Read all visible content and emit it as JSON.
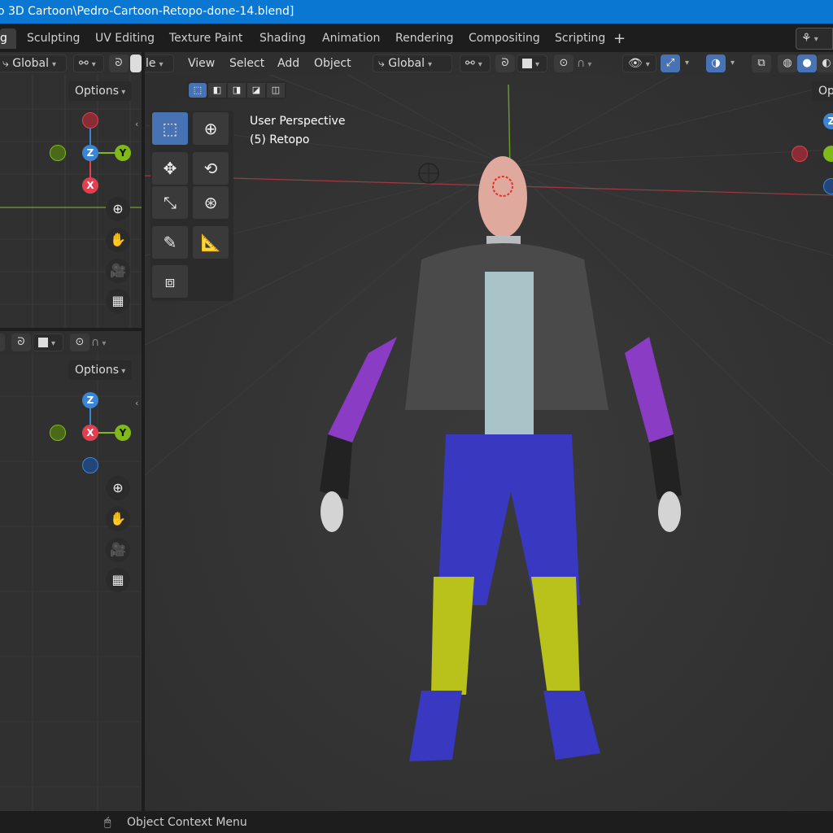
{
  "window": {
    "title": "o 3D Cartoon\\Pedro-Cartoon-Retopo-done-14.blend]"
  },
  "workspaces": {
    "tabs": [
      {
        "label": "g",
        "active": true
      },
      {
        "label": "Sculpting"
      },
      {
        "label": "UV Editing"
      },
      {
        "label": "Texture Paint"
      },
      {
        "label": "Shading"
      },
      {
        "label": "Animation"
      },
      {
        "label": "Rendering"
      },
      {
        "label": "Compositing"
      },
      {
        "label": "Scripting"
      }
    ],
    "add_label": "+"
  },
  "left_top": {
    "orientation": "Global",
    "options_label": "Options",
    "gizmo": {
      "x": "X",
      "y": "Y",
      "z": "Z"
    }
  },
  "left_bottom": {
    "options_label": "Options",
    "gizmo": {
      "x": "X",
      "y": "Y",
      "z": "Z"
    }
  },
  "main_view": {
    "mode_label": "le",
    "menus": [
      "View",
      "Select",
      "Add",
      "Object"
    ],
    "orientation": "Global",
    "perspective_label": "User Perspective",
    "object_label": "(5) Retopo",
    "options_label": "Op"
  },
  "status_bar": {
    "context_menu_label": "Object Context Menu"
  },
  "colors": {
    "title_bar": "#0a77d3",
    "viewport_bg": "#303030",
    "x_axis": "#e04050",
    "y_axis": "#7fba1a",
    "z_axis": "#3a86d4",
    "active_tool": "#4772b3"
  }
}
